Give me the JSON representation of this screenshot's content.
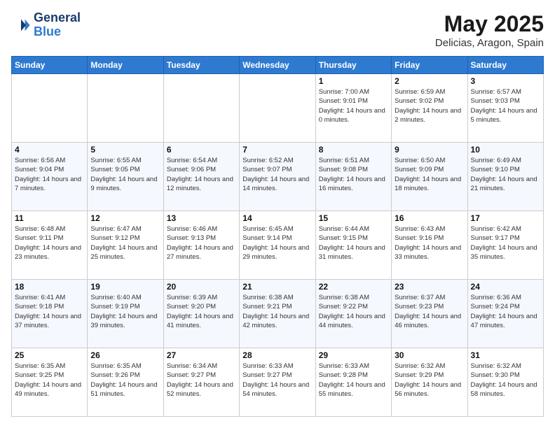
{
  "logo": {
    "line1": "General",
    "line2": "Blue"
  },
  "title": "May 2025",
  "subtitle": "Delicias, Aragon, Spain",
  "days_header": [
    "Sunday",
    "Monday",
    "Tuesday",
    "Wednesday",
    "Thursday",
    "Friday",
    "Saturday"
  ],
  "weeks": [
    [
      {
        "day": "",
        "info": ""
      },
      {
        "day": "",
        "info": ""
      },
      {
        "day": "",
        "info": ""
      },
      {
        "day": "",
        "info": ""
      },
      {
        "day": "1",
        "info": "Sunrise: 7:00 AM\nSunset: 9:01 PM\nDaylight: 14 hours and 0 minutes."
      },
      {
        "day": "2",
        "info": "Sunrise: 6:59 AM\nSunset: 9:02 PM\nDaylight: 14 hours and 2 minutes."
      },
      {
        "day": "3",
        "info": "Sunrise: 6:57 AM\nSunset: 9:03 PM\nDaylight: 14 hours and 5 minutes."
      }
    ],
    [
      {
        "day": "4",
        "info": "Sunrise: 6:56 AM\nSunset: 9:04 PM\nDaylight: 14 hours and 7 minutes."
      },
      {
        "day": "5",
        "info": "Sunrise: 6:55 AM\nSunset: 9:05 PM\nDaylight: 14 hours and 9 minutes."
      },
      {
        "day": "6",
        "info": "Sunrise: 6:54 AM\nSunset: 9:06 PM\nDaylight: 14 hours and 12 minutes."
      },
      {
        "day": "7",
        "info": "Sunrise: 6:52 AM\nSunset: 9:07 PM\nDaylight: 14 hours and 14 minutes."
      },
      {
        "day": "8",
        "info": "Sunrise: 6:51 AM\nSunset: 9:08 PM\nDaylight: 14 hours and 16 minutes."
      },
      {
        "day": "9",
        "info": "Sunrise: 6:50 AM\nSunset: 9:09 PM\nDaylight: 14 hours and 18 minutes."
      },
      {
        "day": "10",
        "info": "Sunrise: 6:49 AM\nSunset: 9:10 PM\nDaylight: 14 hours and 21 minutes."
      }
    ],
    [
      {
        "day": "11",
        "info": "Sunrise: 6:48 AM\nSunset: 9:11 PM\nDaylight: 14 hours and 23 minutes."
      },
      {
        "day": "12",
        "info": "Sunrise: 6:47 AM\nSunset: 9:12 PM\nDaylight: 14 hours and 25 minutes."
      },
      {
        "day": "13",
        "info": "Sunrise: 6:46 AM\nSunset: 9:13 PM\nDaylight: 14 hours and 27 minutes."
      },
      {
        "day": "14",
        "info": "Sunrise: 6:45 AM\nSunset: 9:14 PM\nDaylight: 14 hours and 29 minutes."
      },
      {
        "day": "15",
        "info": "Sunrise: 6:44 AM\nSunset: 9:15 PM\nDaylight: 14 hours and 31 minutes."
      },
      {
        "day": "16",
        "info": "Sunrise: 6:43 AM\nSunset: 9:16 PM\nDaylight: 14 hours and 33 minutes."
      },
      {
        "day": "17",
        "info": "Sunrise: 6:42 AM\nSunset: 9:17 PM\nDaylight: 14 hours and 35 minutes."
      }
    ],
    [
      {
        "day": "18",
        "info": "Sunrise: 6:41 AM\nSunset: 9:18 PM\nDaylight: 14 hours and 37 minutes."
      },
      {
        "day": "19",
        "info": "Sunrise: 6:40 AM\nSunset: 9:19 PM\nDaylight: 14 hours and 39 minutes."
      },
      {
        "day": "20",
        "info": "Sunrise: 6:39 AM\nSunset: 9:20 PM\nDaylight: 14 hours and 41 minutes."
      },
      {
        "day": "21",
        "info": "Sunrise: 6:38 AM\nSunset: 9:21 PM\nDaylight: 14 hours and 42 minutes."
      },
      {
        "day": "22",
        "info": "Sunrise: 6:38 AM\nSunset: 9:22 PM\nDaylight: 14 hours and 44 minutes."
      },
      {
        "day": "23",
        "info": "Sunrise: 6:37 AM\nSunset: 9:23 PM\nDaylight: 14 hours and 46 minutes."
      },
      {
        "day": "24",
        "info": "Sunrise: 6:36 AM\nSunset: 9:24 PM\nDaylight: 14 hours and 47 minutes."
      }
    ],
    [
      {
        "day": "25",
        "info": "Sunrise: 6:35 AM\nSunset: 9:25 PM\nDaylight: 14 hours and 49 minutes."
      },
      {
        "day": "26",
        "info": "Sunrise: 6:35 AM\nSunset: 9:26 PM\nDaylight: 14 hours and 51 minutes."
      },
      {
        "day": "27",
        "info": "Sunrise: 6:34 AM\nSunset: 9:27 PM\nDaylight: 14 hours and 52 minutes."
      },
      {
        "day": "28",
        "info": "Sunrise: 6:33 AM\nSunset: 9:27 PM\nDaylight: 14 hours and 54 minutes."
      },
      {
        "day": "29",
        "info": "Sunrise: 6:33 AM\nSunset: 9:28 PM\nDaylight: 14 hours and 55 minutes."
      },
      {
        "day": "30",
        "info": "Sunrise: 6:32 AM\nSunset: 9:29 PM\nDaylight: 14 hours and 56 minutes."
      },
      {
        "day": "31",
        "info": "Sunrise: 6:32 AM\nSunset: 9:30 PM\nDaylight: 14 hours and 58 minutes."
      }
    ]
  ]
}
